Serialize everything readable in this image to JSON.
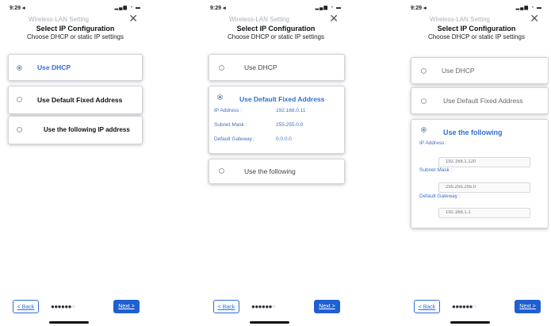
{
  "status_bar": {
    "time": "9:29 ◂",
    "icons": "▂▄▆ ◔ ▬"
  },
  "header": {
    "subtitle": "Wireless-LAN Setting",
    "close_glyph": "✕",
    "title": "Select IP Configuration",
    "description": "Choose DHCP or static IP settings"
  },
  "screen1": {
    "options": [
      {
        "label": "Use DHCP",
        "selected": true
      },
      {
        "label": "Use Default Fixed Address",
        "selected": false
      },
      {
        "label": "Use the following IP address",
        "selected": false
      }
    ]
  },
  "screen2": {
    "option_dhcp": "Use DHCP",
    "option_fixed": "Use Default Fixed Address",
    "fixed_fields": {
      "ip_label": "IP Address :",
      "ip_value": "192.168.0.11",
      "mask_label": "Subnet Mask :",
      "mask_value": "255.255.0.0",
      "gateway_label": "Default Gateway :",
      "gateway_value": "0.0.0.0"
    },
    "option_following": "Use the following"
  },
  "screen3": {
    "option_dhcp": "Use DHCP",
    "option_fixed": "Use Default Fixed Address",
    "option_following": "Use the following",
    "ip_label": "IP Address :",
    "ip_placeholder": "192.168.1.120",
    "mask_label": "Subnet Mask :",
    "mask_placeholder": "255.255.255.0",
    "gateway_label": "Default Gateway :",
    "gateway_placeholder": "192.168.1.1"
  },
  "footer": {
    "back_label": "< Back",
    "next_label": "Next >",
    "dots_on": "●●●●●●",
    "dots_off": "○"
  },
  "icons": [
    "close-icon",
    "radio-icon",
    "signal-icon"
  ],
  "colors": {
    "accent": "#1f5fd0",
    "link_blue": "#3d6fc4",
    "muted": "#aab2bb"
  }
}
